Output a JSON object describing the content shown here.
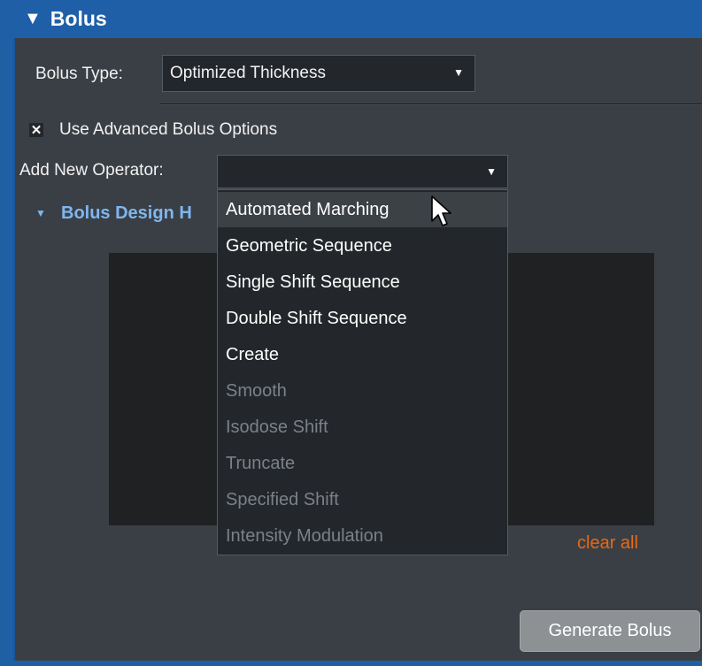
{
  "panel": {
    "title": "Bolus",
    "collapse_glyph": "▼"
  },
  "bolus_type": {
    "label": "Bolus Type:",
    "value": "Optimized Thickness",
    "caret": "▼"
  },
  "advanced": {
    "checkbox_mark": "✕",
    "checked": true,
    "label": "Use Advanced Bolus Options"
  },
  "add_operator": {
    "label": "Add New Operator:",
    "value": "",
    "caret": "▼"
  },
  "section": {
    "glyph": "▼",
    "title": "Bolus Design H"
  },
  "dropdown": {
    "items": [
      {
        "label": "Automated Marching",
        "enabled": true,
        "hover": true
      },
      {
        "label": "Geometric Sequence",
        "enabled": true
      },
      {
        "label": "Single Shift Sequence",
        "enabled": true
      },
      {
        "label": "Double Shift Sequence",
        "enabled": true
      },
      {
        "label": "Create",
        "enabled": true
      },
      {
        "label": "Smooth",
        "enabled": false
      },
      {
        "label": "Isodose Shift",
        "enabled": false
      },
      {
        "label": "Truncate",
        "enabled": false
      },
      {
        "label": "Specified Shift",
        "enabled": false
      },
      {
        "label": "Intensity Modulation",
        "enabled": false
      }
    ]
  },
  "actions": {
    "clear_all": "clear all",
    "generate": "Generate Bolus"
  },
  "colors": {
    "header": "#1f5fa8",
    "panel": "#3a3f45",
    "section_title": "#7fb6ef",
    "clear_all": "#e86a12",
    "disabled_text": "#7c8188"
  }
}
